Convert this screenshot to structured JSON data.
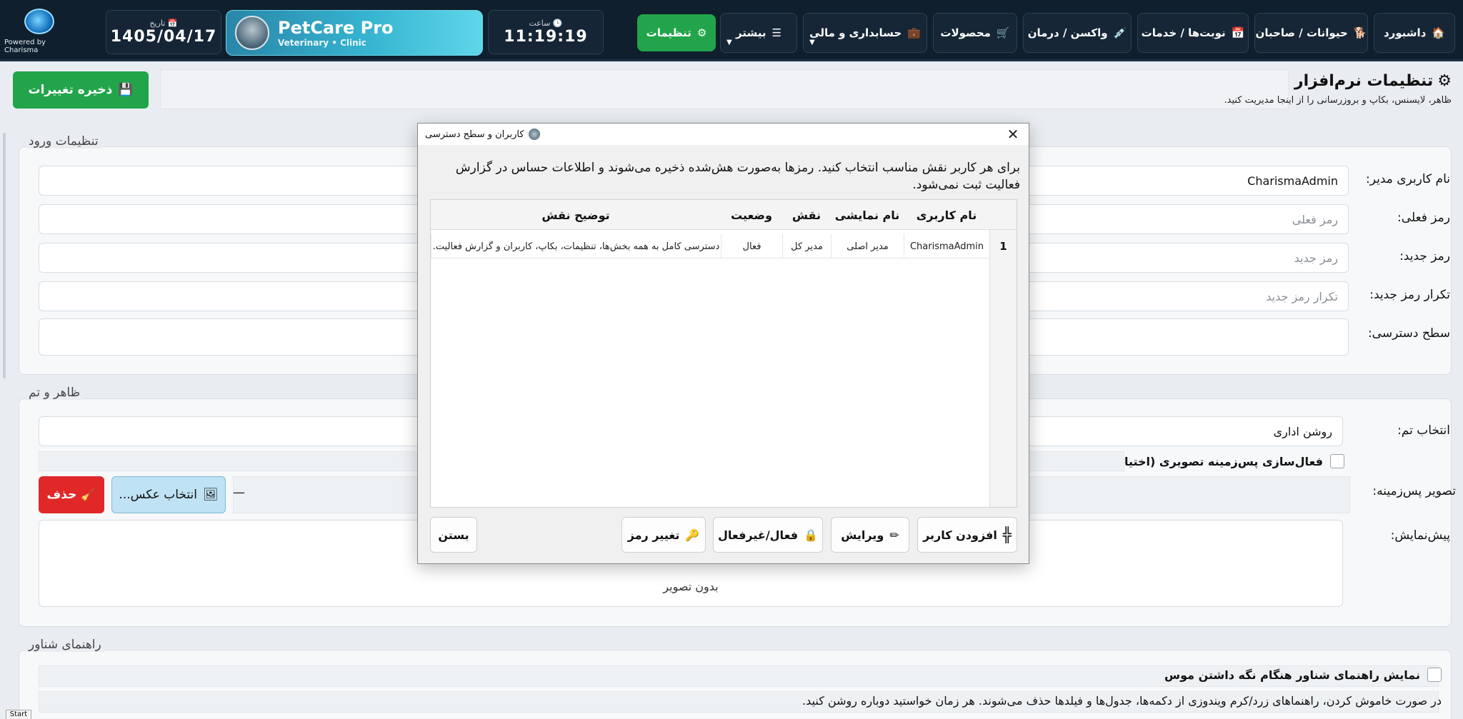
{
  "nav": {
    "items": [
      {
        "label": "داشبورد",
        "icon": "🏠"
      },
      {
        "label": "حیوانات / صاحبان",
        "icon": "🐕"
      },
      {
        "label": "نوبت‌ها / خدمات",
        "icon": "📅"
      },
      {
        "label": "واکسن / درمان",
        "icon": "💉"
      },
      {
        "label": "محصولات",
        "icon": "🛒"
      },
      {
        "label": "حسابداری و مالی",
        "icon": "💼"
      },
      {
        "label": "بیشتر",
        "icon": "☰"
      },
      {
        "label": "تنظیمات",
        "icon": "⚙"
      }
    ],
    "clock_caption": "ساعت",
    "clock_value": "11:19:19",
    "date_caption": "تاریخ",
    "date_value": "1405/04/17",
    "brand_title": "PetCare Pro",
    "brand_subtitle": "Veterinary • Clinic",
    "powered_by": "Powered by Charisma"
  },
  "header": {
    "save_label": "ذخیره تغییرات",
    "title": "تنظیمات نرم‌افزار",
    "subtitle": "ظاهر، لایسنس، بکاپ و بروزرسانی را از اینجا مدیریت کنید."
  },
  "login": {
    "legend": "تنظیمات ورود",
    "admin_label": "نام کاربری مدیر:",
    "admin_value": "CharismaAdmin",
    "current_label": "رمز فعلی:",
    "current_placeholder": "رمز فعلی",
    "new_label": "رمز جدید:",
    "new_placeholder": "رمز جدید",
    "repeat_label": "تکرار رمز جدید:",
    "repeat_placeholder": "تکرار رمز جدید",
    "access_label": "سطح دسترسی:"
  },
  "theme": {
    "legend": "ظاهر و تم",
    "select_label": "انتخاب تم:",
    "select_value": "روشن اداری",
    "bg_checkbox_label": "فعال‌سازی پس‌زمینه تصویری (اختیاری)",
    "bg_label": "تصویر پس‌زمینه:",
    "bg_value": "—",
    "pick_label": "انتخاب عکس...",
    "delete_label": "حذف",
    "preview_label": "پیش‌نمایش:",
    "preview_empty": "بدون تصویر"
  },
  "tooltip": {
    "legend": "راهنمای شناور",
    "checkbox_label": "نمایش راهنمای شناور هنگام نگه داشتن موس",
    "note": "در صورت خاموش کردن، راهنماهای زرد/کرم ویندوزی از دکمه‌ها، جدول‌ها و فیلدها حذف می‌شوند. هر زمان خواستید دوباره روشن کنید."
  },
  "dialog": {
    "title": "کاربران و سطح دسترسی",
    "message": "برای هر کاربر نقش مناسب انتخاب کنید. رمزها به‌صورت هش‌شده ذخیره می‌شوند و اطلاعات حساس در گزارش فعالیت ثبت نمی‌شود.",
    "columns": [
      "نام کاربری",
      "نام نمایشی",
      "نقش",
      "وضعیت",
      "توضیح نقش"
    ],
    "rows": [
      {
        "num": "1",
        "username": "CharismaAdmin",
        "display": "مدیر اصلی",
        "role": "مدیر کل",
        "status": "فعال",
        "desc": "دسترسی کامل به همه بخش‌ها، تنظیمات، بکاپ، کاربران و گزارش فعالیت."
      }
    ],
    "add_label": "افزودن کاربر",
    "edit_label": "ویرایش",
    "toggle_label": "فعال/غیرفعال",
    "password_label": "تغییر رمز",
    "close_label": "بستن"
  },
  "taskbar": {
    "start_label": "Start"
  }
}
